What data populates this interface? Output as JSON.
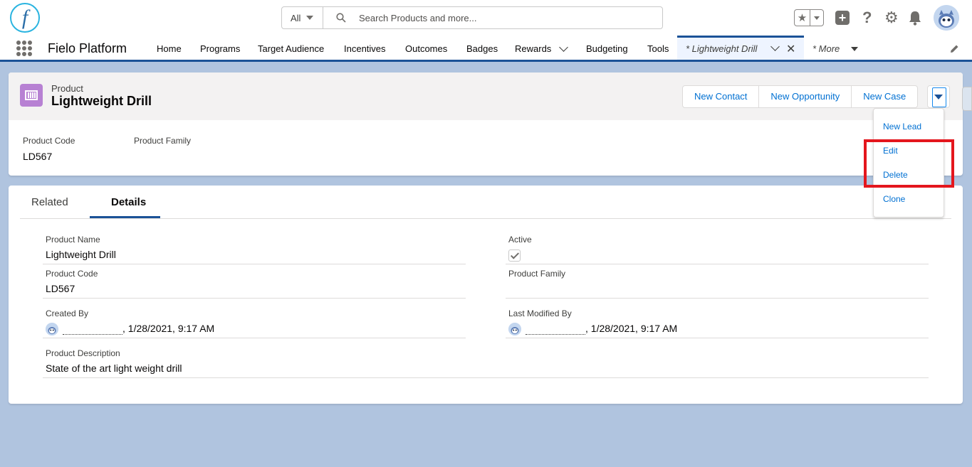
{
  "header": {
    "logo_letter": "f",
    "search": {
      "scope": "All",
      "placeholder": "Search Products and more..."
    }
  },
  "nav": {
    "app_name": "Fielo Platform",
    "items": [
      "Home",
      "Programs",
      "Target Audience",
      "Incentives",
      "Outcomes",
      "Badges",
      "Rewards",
      "Budgeting",
      "Tools"
    ],
    "active_tab": "* Lightweight Drill",
    "more": "* More"
  },
  "record": {
    "object_type": "Product",
    "name": "Lightweight Drill",
    "actions": [
      "New Contact",
      "New Opportunity",
      "New Case"
    ],
    "menu_items": [
      "New Lead",
      "Edit",
      "Delete",
      "Clone"
    ],
    "highlights": [
      {
        "label": "Product Code",
        "value": "LD567"
      },
      {
        "label": "Product Family",
        "value": ""
      }
    ]
  },
  "tabs": [
    "Related",
    "Details"
  ],
  "details": {
    "product_name": {
      "label": "Product Name",
      "value": "Lightweight Drill"
    },
    "active": {
      "label": "Active",
      "checked": true
    },
    "product_code": {
      "label": "Product Code",
      "value": "LD567"
    },
    "product_family": {
      "label": "Product Family",
      "value": ""
    },
    "created_by": {
      "label": "Created By",
      "date": ", 1/28/2021, 9:17 AM"
    },
    "last_modified_by": {
      "label": "Last Modified By",
      "date": ", 1/28/2021, 9:17 AM"
    },
    "product_description": {
      "label": "Product Description",
      "value": "State of the art light weight drill"
    }
  },
  "colors": {
    "brand": "#1b5297",
    "link": "#0070d2",
    "highlight": "#e4161d",
    "product_icon": "#b781d3",
    "background": "#b0c4df"
  }
}
